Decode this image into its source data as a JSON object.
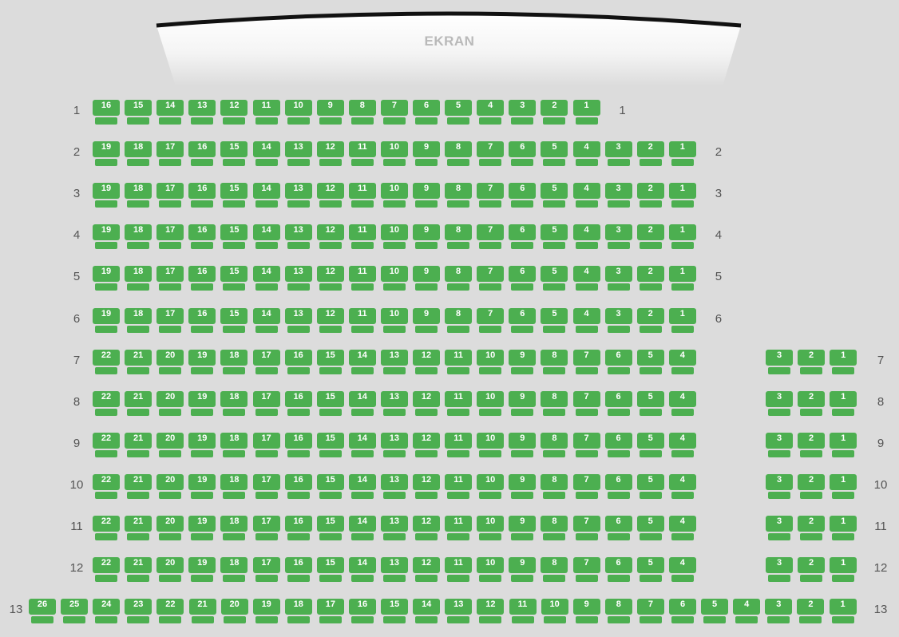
{
  "screen": {
    "label": "EKRAN"
  },
  "colors": {
    "available": "#4caf50",
    "background": "#dcdcdc",
    "label": "#555555"
  },
  "rows": [
    {
      "number": "1",
      "left": [
        "16",
        "15",
        "14",
        "13",
        "12",
        "11",
        "10",
        "9",
        "8",
        "7",
        "6",
        "5",
        "4",
        "3",
        "2",
        "1"
      ],
      "right": []
    },
    {
      "number": "2",
      "left": [
        "19",
        "18",
        "17",
        "16",
        "15",
        "14",
        "13",
        "12",
        "11",
        "10",
        "9",
        "8",
        "7",
        "6",
        "5",
        "4",
        "3",
        "2",
        "1"
      ],
      "right": []
    },
    {
      "number": "3",
      "left": [
        "19",
        "18",
        "17",
        "16",
        "15",
        "14",
        "13",
        "12",
        "11",
        "10",
        "9",
        "8",
        "7",
        "6",
        "5",
        "4",
        "3",
        "2",
        "1"
      ],
      "right": []
    },
    {
      "number": "4",
      "left": [
        "19",
        "18",
        "17",
        "16",
        "15",
        "14",
        "13",
        "12",
        "11",
        "10",
        "9",
        "8",
        "7",
        "6",
        "5",
        "4",
        "3",
        "2",
        "1"
      ],
      "right": []
    },
    {
      "number": "5",
      "left": [
        "19",
        "18",
        "17",
        "16",
        "15",
        "14",
        "13",
        "12",
        "11",
        "10",
        "9",
        "8",
        "7",
        "6",
        "5",
        "4",
        "3",
        "2",
        "1"
      ],
      "right": []
    },
    {
      "number": "6",
      "left": [
        "19",
        "18",
        "17",
        "16",
        "15",
        "14",
        "13",
        "12",
        "11",
        "10",
        "9",
        "8",
        "7",
        "6",
        "5",
        "4",
        "3",
        "2",
        "1"
      ],
      "right": []
    },
    {
      "number": "7",
      "left": [
        "22",
        "21",
        "20",
        "19",
        "18",
        "17",
        "16",
        "15",
        "14",
        "13",
        "12",
        "11",
        "10",
        "9",
        "8",
        "7",
        "6",
        "5",
        "4"
      ],
      "right": [
        "3",
        "2",
        "1"
      ]
    },
    {
      "number": "8",
      "left": [
        "22",
        "21",
        "20",
        "19",
        "18",
        "17",
        "16",
        "15",
        "14",
        "13",
        "12",
        "11",
        "10",
        "9",
        "8",
        "7",
        "6",
        "5",
        "4"
      ],
      "right": [
        "3",
        "2",
        "1"
      ]
    },
    {
      "number": "9",
      "left": [
        "22",
        "21",
        "20",
        "19",
        "18",
        "17",
        "16",
        "15",
        "14",
        "13",
        "12",
        "11",
        "10",
        "9",
        "8",
        "7",
        "6",
        "5",
        "4"
      ],
      "right": [
        "3",
        "2",
        "1"
      ]
    },
    {
      "number": "10",
      "left": [
        "22",
        "21",
        "20",
        "19",
        "18",
        "17",
        "16",
        "15",
        "14",
        "13",
        "12",
        "11",
        "10",
        "9",
        "8",
        "7",
        "6",
        "5",
        "4"
      ],
      "right": [
        "3",
        "2",
        "1"
      ]
    },
    {
      "number": "11",
      "left": [
        "22",
        "21",
        "20",
        "19",
        "18",
        "17",
        "16",
        "15",
        "14",
        "13",
        "12",
        "11",
        "10",
        "9",
        "8",
        "7",
        "6",
        "5",
        "4"
      ],
      "right": [
        "3",
        "2",
        "1"
      ]
    },
    {
      "number": "12",
      "left": [
        "22",
        "21",
        "20",
        "19",
        "18",
        "17",
        "16",
        "15",
        "14",
        "13",
        "12",
        "11",
        "10",
        "9",
        "8",
        "7",
        "6",
        "5",
        "4"
      ],
      "right": [
        "3",
        "2",
        "1"
      ]
    },
    {
      "number": "13",
      "left": [
        "26",
        "25",
        "24",
        "23",
        "22",
        "21",
        "20",
        "19",
        "18",
        "17",
        "16",
        "15",
        "14",
        "13",
        "12",
        "11",
        "10",
        "9",
        "8",
        "7",
        "6",
        "5",
        "4",
        "3",
        "2",
        "1"
      ],
      "right": []
    }
  ]
}
